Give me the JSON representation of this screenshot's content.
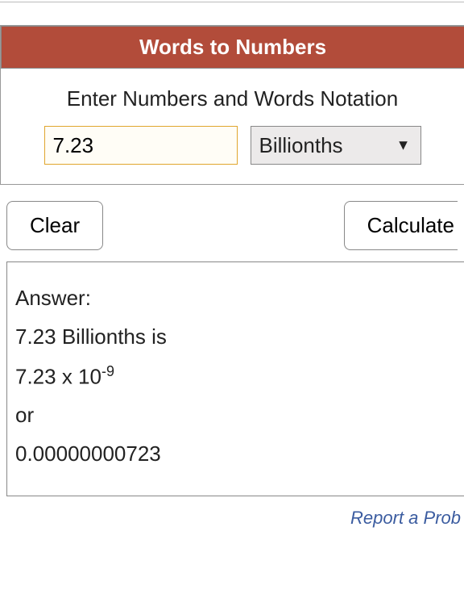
{
  "header": {
    "title": "Words to Numbers"
  },
  "instruction": "Enter Numbers and Words Notation",
  "inputs": {
    "number_value": "7.23",
    "unit_selected": "Billionths"
  },
  "buttons": {
    "clear": "Clear",
    "calculate": "Calculate"
  },
  "answer": {
    "label": "Answer:",
    "line1": "7.23 Billionths is",
    "sci_base": "7.23 x 10",
    "sci_exp": "-9",
    "or": "or",
    "decimal": "0.00000000723"
  },
  "footer": {
    "report": "Report a Prob"
  }
}
